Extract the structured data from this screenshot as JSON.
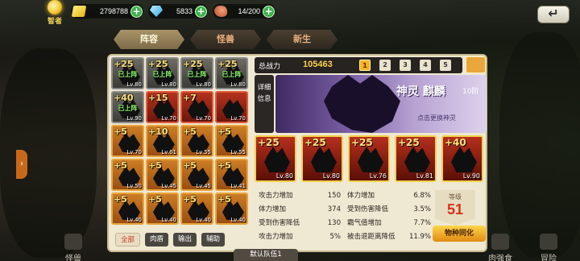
{
  "topbar": {
    "sage_label": "智者",
    "gold": "2798788",
    "gems": "5833",
    "stamina": "14/200",
    "plus": "+"
  },
  "tabs": [
    "阵容",
    "怪兽",
    "新生"
  ],
  "roster": [
    {
      "rank": "+25",
      "tag": "已上阵",
      "lv": "Lv.80",
      "style": "deployed"
    },
    {
      "rank": "+25",
      "tag": "已上阵",
      "lv": "Lv.80",
      "style": "deployed"
    },
    {
      "rank": "+25",
      "tag": "已上阵",
      "lv": "Lv.80",
      "style": "deployed"
    },
    {
      "rank": "+25",
      "tag": "已上阵",
      "lv": "Lv.80",
      "style": "deployed"
    },
    {
      "rank": "+40",
      "tag": "已上阵",
      "lv": "Lv.90",
      "style": "deployed"
    },
    {
      "rank": "+15",
      "tag": "",
      "lv": "Lv.70",
      "style": "red"
    },
    {
      "rank": "+7",
      "tag": "",
      "lv": "Lv.70",
      "style": "red"
    },
    {
      "rank": "",
      "tag": "",
      "lv": "Lv.70",
      "style": "red"
    },
    {
      "rank": "+5",
      "tag": "",
      "lv": "Lv.70",
      "style": "orange"
    },
    {
      "rank": "+10",
      "tag": "",
      "lv": "Lv.61",
      "style": "orange"
    },
    {
      "rank": "+5",
      "tag": "",
      "lv": "Lv.55",
      "style": "orange"
    },
    {
      "rank": "+5",
      "tag": "",
      "lv": "Lv.55",
      "style": "orange"
    },
    {
      "rank": "+5",
      "tag": "",
      "lv": "Lv.50",
      "style": "orange"
    },
    {
      "rank": "+5",
      "tag": "",
      "lv": "Lv.45",
      "style": "orange"
    },
    {
      "rank": "+5",
      "tag": "",
      "lv": "Lv.45",
      "style": "orange"
    },
    {
      "rank": "+5",
      "tag": "",
      "lv": "Lv.41",
      "style": "orange"
    },
    {
      "rank": "+5",
      "tag": "",
      "lv": "Lv.40",
      "style": "orange"
    },
    {
      "rank": "+5",
      "tag": "",
      "lv": "Lv.40",
      "style": "orange"
    },
    {
      "rank": "+5",
      "tag": "",
      "lv": "Lv.40",
      "style": "orange"
    },
    {
      "rank": "+5",
      "tag": "",
      "lv": "Lv.40",
      "style": "orange"
    }
  ],
  "filters": [
    "全部",
    "肉盾",
    "输出",
    "辅助"
  ],
  "power": {
    "label": "总战力",
    "value": "105463",
    "pages": [
      "1",
      "2",
      "3",
      "4",
      "5"
    ]
  },
  "detail": {
    "side_label": "详细信息",
    "god_name": "神灵 麒麟",
    "god_tier": "10阶",
    "change_hint": "点击更换神灵"
  },
  "team": [
    {
      "rank": "+25",
      "lv": "Lv.80"
    },
    {
      "rank": "+25",
      "lv": "Lv.80"
    },
    {
      "rank": "+25",
      "lv": "Lv.76"
    },
    {
      "rank": "+25",
      "lv": "Lv.81"
    },
    {
      "rank": "+40",
      "lv": "Lv.90"
    }
  ],
  "stats": [
    {
      "k1": "攻击力增加",
      "v1": "150",
      "k2": "体力增加",
      "v2": "6.8%"
    },
    {
      "k1": "体力增加",
      "v1": "374",
      "k2": "受到伤害降低",
      "v2": "3.5%"
    },
    {
      "k1": "受到伤害降低",
      "v1": "130",
      "k2": "霸气值增加",
      "v2": "7.7%"
    },
    {
      "k1": "攻击力增加",
      "v1": "5%",
      "k2": "被击退距离降低",
      "v2": "11.9%"
    }
  ],
  "level": {
    "label": "等级",
    "value": "51"
  },
  "assimilate": "物种同化",
  "team_name": "默认队伍1",
  "bottom_nav": [
    "怪兽",
    "肉强食",
    "冒险"
  ]
}
